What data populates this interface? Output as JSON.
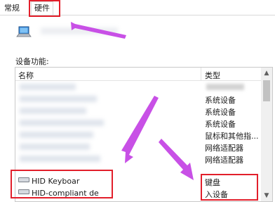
{
  "tabs": [
    {
      "label": "常规"
    },
    {
      "label": "硬件"
    }
  ],
  "device_section_label": "设备功能:",
  "columns": {
    "name": "名称",
    "type": "类型"
  },
  "rows": [
    {
      "name": "",
      "type": ""
    },
    {
      "name": "",
      "type": "系统设备"
    },
    {
      "name": "",
      "type": "系统设备"
    },
    {
      "name": "",
      "type": "系统设备"
    },
    {
      "name": "",
      "type": "鼠标和其他指..."
    },
    {
      "name": "",
      "type": "网络适配器"
    },
    {
      "name": "",
      "type": "网络适配器"
    },
    {
      "name": "HID Keyboar",
      "type": "键盘"
    },
    {
      "name": "HID-compliant de",
      "type": "入设备"
    }
  ],
  "icons": [
    "laptop-icon",
    "keyboard-device-icon",
    "hid-device-icon",
    "scroll-up-icon",
    "scroll-down-icon"
  ],
  "colors": {
    "highlight": "#e21f2b",
    "arrow": "#c850e6"
  }
}
